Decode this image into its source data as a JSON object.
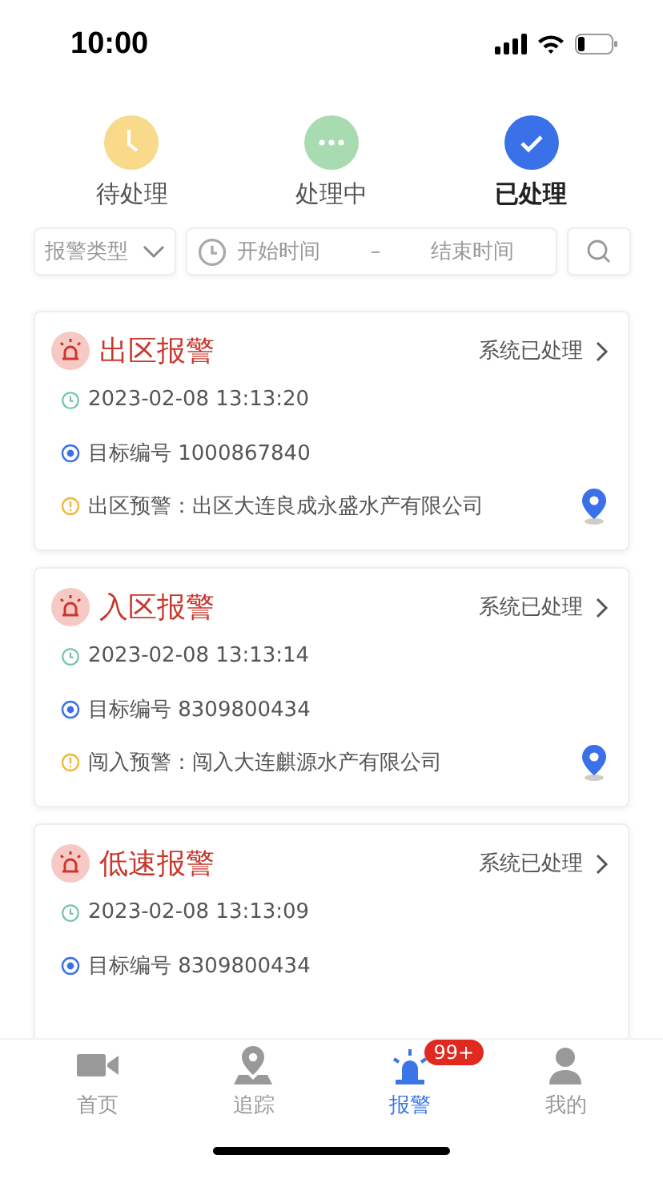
{
  "status_bar": {
    "time": "10:00"
  },
  "tabs": [
    {
      "label": "待处理",
      "kind": "pending",
      "selected": false
    },
    {
      "label": "处理中",
      "kind": "processing",
      "selected": false
    },
    {
      "label": "已处理",
      "kind": "done",
      "selected": true
    }
  ],
  "filters": {
    "type": "报警类型",
    "start_placeholder": "开始时间",
    "separator": "–",
    "end_placeholder": "结束时间"
  },
  "alarms": [
    {
      "title": "出区报警",
      "status": "系统已处理",
      "time": "2023-02-08 13:13:20",
      "target": "目标编号 1000867840",
      "warning": "出区预警：出区大连良成永盛水产有限公司"
    },
    {
      "title": "入区报警",
      "status": "系统已处理",
      "time": "2023-02-08 13:13:14",
      "target": "目标编号 8309800434",
      "warning": "闯入预警：闯入大连麒源水产有限公司"
    },
    {
      "title": "低速报警",
      "status": "系统已处理",
      "time": "2023-02-08 13:13:09",
      "target": "目标编号 8309800434"
    }
  ],
  "tab_bar": [
    {
      "label": "首页",
      "kind": "video",
      "selected": false
    },
    {
      "label": "追踪",
      "kind": "pin",
      "selected": false
    },
    {
      "label": "报警",
      "kind": "alarm",
      "selected": true,
      "badge": "99+"
    },
    {
      "label": "我的",
      "kind": "person",
      "selected": false
    }
  ]
}
